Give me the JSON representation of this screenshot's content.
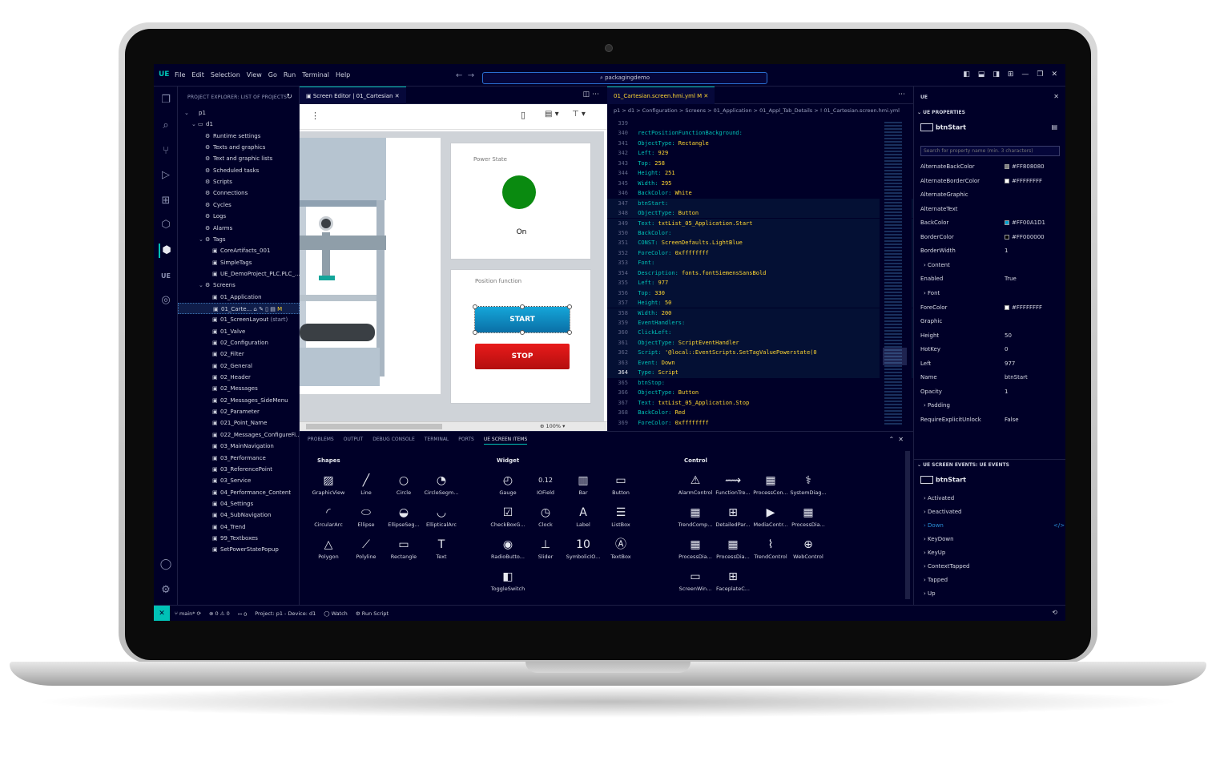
{
  "window": {
    "logo": "UE",
    "menu": [
      "File",
      "Edit",
      "Selection",
      "View",
      "Go",
      "Run",
      "Terminal",
      "Help"
    ],
    "search": "packagingdemo"
  },
  "explorer": {
    "title": "PROJECT EXPLORER: LIST OF PROJECTS",
    "nodes": [
      {
        "t": "p1",
        "d": 0
      },
      {
        "t": "d1",
        "d": 1
      },
      {
        "t": "Runtime settings",
        "d": 2
      },
      {
        "t": "Texts and graphics",
        "d": 2
      },
      {
        "t": "Text and graphic lists",
        "d": 2
      },
      {
        "t": "Scheduled tasks",
        "d": 2
      },
      {
        "t": "Scripts",
        "d": 2
      },
      {
        "t": "Connections",
        "d": 2
      },
      {
        "t": "Cycles",
        "d": 2
      },
      {
        "t": "Logs",
        "d": 2
      },
      {
        "t": "Alarms",
        "d": 2
      },
      {
        "t": "Tags",
        "d": 2
      },
      {
        "t": "CoreArtifacts_001",
        "d": 3
      },
      {
        "t": "SimpleTags",
        "d": 3
      },
      {
        "t": "UE_DemoProject_PLC.PLC_...",
        "d": 3
      },
      {
        "t": "Screens",
        "d": 2
      },
      {
        "t": "01_Application",
        "d": 3
      },
      {
        "t": "01_Carte...",
        "d": 3
      },
      {
        "t": "01_ScreenLayout",
        "d": 3
      },
      {
        "t": "01_Valve",
        "d": 3
      },
      {
        "t": "02_Configuration",
        "d": 3
      },
      {
        "t": "02_Filter",
        "d": 3
      },
      {
        "t": "02_General",
        "d": 3
      },
      {
        "t": "02_Header",
        "d": 3
      },
      {
        "t": "02_Messages",
        "d": 3
      },
      {
        "t": "02_Messages_SideMenu",
        "d": 3
      },
      {
        "t": "02_Parameter",
        "d": 3
      },
      {
        "t": "021_Point_Name",
        "d": 3
      },
      {
        "t": "022_Messages_ConfigureFi...",
        "d": 3
      },
      {
        "t": "03_MainNavigation",
        "d": 3
      },
      {
        "t": "03_Performance",
        "d": 3
      },
      {
        "t": "03_ReferencePoint",
        "d": 3
      },
      {
        "t": "03_Service",
        "d": 3
      },
      {
        "t": "04_Performance_Content",
        "d": 3
      },
      {
        "t": "04_Settings",
        "d": 3
      },
      {
        "t": "04_SubNavigation",
        "d": 3
      },
      {
        "t": "04_Trend",
        "d": 3
      },
      {
        "t": "99_Textboxes",
        "d": 3
      },
      {
        "t": "SetPowerStatePopup",
        "d": 3
      }
    ],
    "start_badge": "(start)",
    "modified_badge": "M"
  },
  "editor": {
    "tab": "Screen Editor | 01_Cartesian",
    "power_state_label": "Power State",
    "power_state_value": "On",
    "position_label": "Position function",
    "start": "START",
    "stop": "STOP",
    "zoom": "100%",
    "state_color": "#0a8a10"
  },
  "code": {
    "tab": "01_Cartesian.screen.hmi.yml M",
    "crumb": "p1 > d1 > Configuration > Screens > 01_Application > 01_Appl_Tab_Details > ! 01_Cartesian.screen.hmi.yml",
    "lines": [
      {
        "n": "339",
        "i": 0,
        "k": "",
        "v": ""
      },
      {
        "n": "340",
        "i": 2,
        "k": "rectPositionFunctionBackground:",
        "v": ""
      },
      {
        "n": "341",
        "i": 3,
        "k": "ObjectType:",
        "v": "Rectangle"
      },
      {
        "n": "342",
        "i": 3,
        "k": "Left:",
        "v": "929"
      },
      {
        "n": "343",
        "i": 3,
        "k": "Top:",
        "v": "258"
      },
      {
        "n": "344",
        "i": 3,
        "k": "Height:",
        "v": "251"
      },
      {
        "n": "345",
        "i": 3,
        "k": "Width:",
        "v": "295"
      },
      {
        "n": "346",
        "i": 3,
        "k": "BackColor:",
        "v": "White"
      },
      {
        "n": "347",
        "i": 2,
        "k": "btnStart:",
        "v": ""
      },
      {
        "n": "348",
        "i": 3,
        "k": "ObjectType:",
        "v": "Button"
      },
      {
        "n": "349",
        "i": 3,
        "k": "Text:",
        "v": "txtList_05_Application.Start"
      },
      {
        "n": "350",
        "i": 3,
        "k": "BackColor:",
        "v": ""
      },
      {
        "n": "351",
        "i": 4,
        "k": "CONST:",
        "v": "ScreenDefaults.LightBlue"
      },
      {
        "n": "352",
        "i": 3,
        "k": "ForeColor:",
        "v": "0xffffffff"
      },
      {
        "n": "353",
        "i": 3,
        "k": "Font:",
        "v": ""
      },
      {
        "n": "354",
        "i": 4,
        "k": "Description:",
        "v": "fonts.fontSiemensSansBold"
      },
      {
        "n": "355",
        "i": 3,
        "k": "Left:",
        "v": "977"
      },
      {
        "n": "356",
        "i": 3,
        "k": "Top:",
        "v": "330"
      },
      {
        "n": "357",
        "i": 3,
        "k": "Height:",
        "v": "50"
      },
      {
        "n": "358",
        "i": 3,
        "k": "Width:",
        "v": "200"
      },
      {
        "n": "359",
        "i": 3,
        "k": "EventHandlers:",
        "v": ""
      },
      {
        "n": "360",
        "i": 4,
        "k": "ClickLeft:",
        "v": ""
      },
      {
        "n": "361",
        "i": 5,
        "k": "ObjectType:",
        "v": "ScriptEventHandler"
      },
      {
        "n": "362",
        "i": 5,
        "k": "Script:",
        "v": "'@local::EventScripts.SetTagValuePowerstate(0"
      },
      {
        "n": "363",
        "i": 5,
        "k": "Event:",
        "v": "Down"
      },
      {
        "n": "364",
        "i": 5,
        "k": "Type:",
        "v": "Script"
      },
      {
        "n": "365",
        "i": 2,
        "k": "btnStop:",
        "v": ""
      },
      {
        "n": "366",
        "i": 3,
        "k": "ObjectType:",
        "v": "Button"
      },
      {
        "n": "367",
        "i": 3,
        "k": "Text:",
        "v": "txtList_05_Application.Stop"
      },
      {
        "n": "368",
        "i": 3,
        "k": "BackColor:",
        "v": "Red"
      },
      {
        "n": "369",
        "i": 3,
        "k": "ForeColor:",
        "v": "0xffffffff"
      }
    ]
  },
  "props": {
    "header": "UE",
    "section": "UE PROPERTIES",
    "object": "btnStart",
    "search_placeholder": "Search for property name (min. 3 characters)",
    "rows": [
      {
        "k": "AlternateBackColor",
        "v": "#FF808080",
        "sw": "#808080"
      },
      {
        "k": "AlternateBorderColor",
        "v": "#FFFFFFFF",
        "sw": "#ffffff"
      },
      {
        "k": "AlternateGraphic",
        "v": ""
      },
      {
        "k": "AlternateText",
        "v": ""
      },
      {
        "k": "BackColor",
        "v": "#FF00A1D1",
        "sw": "#00a1d1"
      },
      {
        "k": "BorderColor",
        "v": "#FF000000",
        "sw": "#000000"
      },
      {
        "k": "BorderWidth",
        "v": "1"
      },
      {
        "k": "Content",
        "v": "",
        "exp": true
      },
      {
        "k": "Enabled",
        "v": "True"
      },
      {
        "k": "Font",
        "v": "",
        "exp": true
      },
      {
        "k": "ForeColor",
        "v": "#FFFFFFFF",
        "sw": "#ffffff"
      },
      {
        "k": "Graphic",
        "v": ""
      },
      {
        "k": "Height",
        "v": "50"
      },
      {
        "k": "HotKey",
        "v": "0"
      },
      {
        "k": "Left",
        "v": "977"
      },
      {
        "k": "Name",
        "v": "btnStart"
      },
      {
        "k": "Opacity",
        "v": "1"
      },
      {
        "k": "Padding",
        "v": "",
        "exp": true
      },
      {
        "k": "RequireExplicitUnlock",
        "v": "False"
      }
    ],
    "events_section": "UE SCREEN EVENTS: UE EVENTS",
    "events_object": "btnStart",
    "events": [
      "Activated",
      "Deactivated",
      "Down",
      "KeyDown",
      "KeyUp",
      "ContextTapped",
      "Tapped",
      "Up"
    ]
  },
  "panel": {
    "tabs": [
      "PROBLEMS",
      "OUTPUT",
      "DEBUG CONSOLE",
      "TERMINAL",
      "PORTS",
      "UE SCREEN ITEMS"
    ],
    "shapes_title": "Shapes",
    "widget_title": "Widget",
    "control_title": "Control",
    "shapes": [
      {
        "l": "GraphicView",
        "g": "▨"
      },
      {
        "l": "Line",
        "g": "╱"
      },
      {
        "l": "Circle",
        "g": "○"
      },
      {
        "l": "CircleSegm...",
        "g": "◔"
      },
      {
        "l": "CircularArc",
        "g": "◜"
      },
      {
        "l": "Ellipse",
        "g": "⬭"
      },
      {
        "l": "EllipseSeg...",
        "g": "◒"
      },
      {
        "l": "EllipticalArc",
        "g": "◡"
      },
      {
        "l": "Polygon",
        "g": "△"
      },
      {
        "l": "Polyline",
        "g": "⟋"
      },
      {
        "l": "Rectangle",
        "g": "▭"
      },
      {
        "l": "Text",
        "g": "T"
      }
    ],
    "widgets": [
      {
        "l": "Gauge",
        "g": "◴"
      },
      {
        "l": "IOField",
        "g": "0.12"
      },
      {
        "l": "Bar",
        "g": "▥"
      },
      {
        "l": "Button",
        "g": "▭"
      },
      {
        "l": "CheckBoxG...",
        "g": "☑"
      },
      {
        "l": "Clock",
        "g": "◷"
      },
      {
        "l": "Label",
        "g": "A"
      },
      {
        "l": "ListBox",
        "g": "☰"
      },
      {
        "l": "RadioButto...",
        "g": "◉"
      },
      {
        "l": "Slider",
        "g": "⊥"
      },
      {
        "l": "SymbolicIO...",
        "g": "10"
      },
      {
        "l": "TextBox",
        "g": "Ⓐ"
      },
      {
        "l": "ToggleSwitch",
        "g": "◧"
      }
    ],
    "controls": [
      {
        "l": "AlarmControl",
        "g": "⚠"
      },
      {
        "l": "FunctionTre...",
        "g": "⟿"
      },
      {
        "l": "ProcessCon...",
        "g": "▦"
      },
      {
        "l": "SystemDiag...",
        "g": "⚕"
      },
      {
        "l": "TrendComp...",
        "g": "▦"
      },
      {
        "l": "DetailedPar...",
        "g": "⊞"
      },
      {
        "l": "MediaContr...",
        "g": "▶"
      },
      {
        "l": "ProcessDia...",
        "g": "▦"
      },
      {
        "l": "ProcessDia...",
        "g": "▦"
      },
      {
        "l": "ProcessDia...",
        "g": "▦"
      },
      {
        "l": "TrendControl",
        "g": "⌇"
      },
      {
        "l": "WebControl",
        "g": "⊕"
      },
      {
        "l": "ScreenWin...",
        "g": "▭"
      },
      {
        "l": "FaceplateC...",
        "g": "⊞"
      }
    ]
  },
  "status": {
    "branch": "main*",
    "problems": "⊗ 0 ⚠ 0",
    "ports": "ꟷ 0",
    "project": "Project: p1 - Device: d1",
    "watch": "Watch",
    "run": "Run Script"
  }
}
